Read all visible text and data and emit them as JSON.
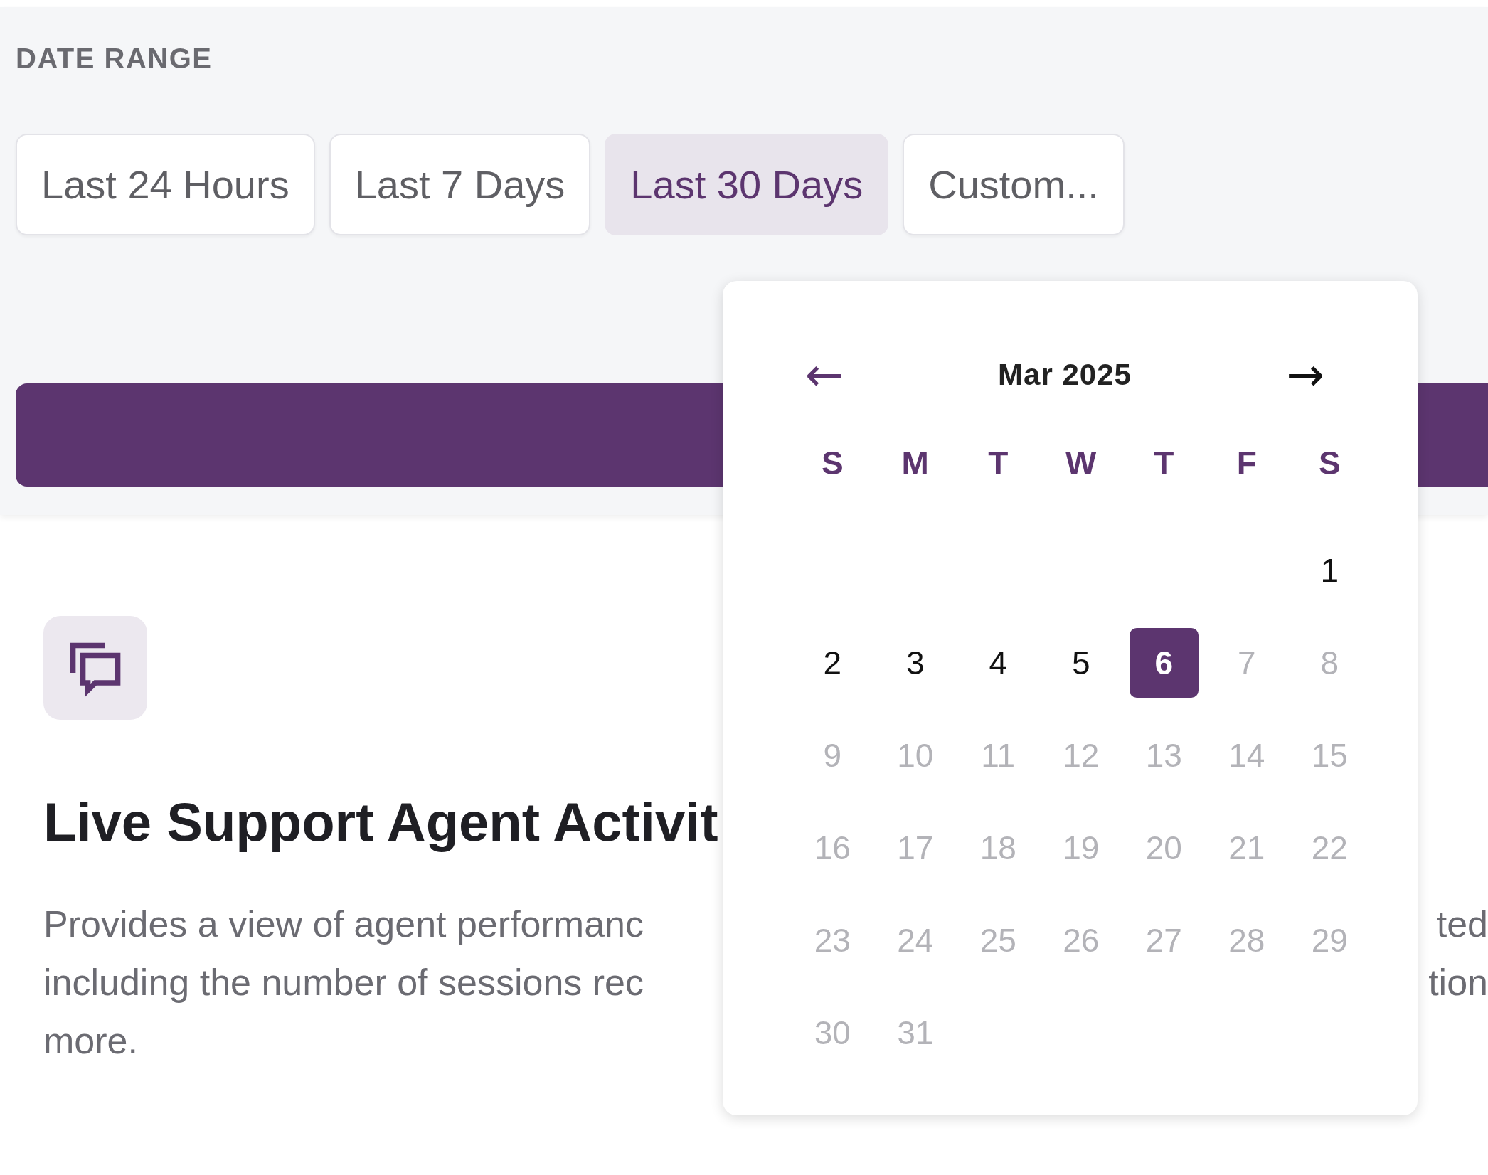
{
  "date_range": {
    "label": "DATE RANGE",
    "presets": [
      {
        "label": "Last 24 Hours",
        "selected": false
      },
      {
        "label": "Last 7 Days",
        "selected": false
      },
      {
        "label": "Last 30 Days",
        "selected": true
      },
      {
        "label": "Custom...",
        "selected": false
      }
    ]
  },
  "report": {
    "title": "Live Support Agent Activit",
    "description_lines": [
      {
        "left": "Provides a view of agent performanc",
        "right": "ted"
      },
      {
        "left": "including the number of sessions rec",
        "right": "tion"
      },
      {
        "left": "more."
      }
    ]
  },
  "calendar": {
    "prev": "←",
    "month": "Mar 2025",
    "next": "→",
    "weekdays": [
      "S",
      "M",
      "T",
      "W",
      "T",
      "F",
      "S"
    ],
    "weeks": [
      {
        "days": [
          {
            "day": "1",
            "selected": false,
            "disabled": false
          }
        ]
      },
      {
        "days": [
          {
            "day": "2",
            "selected": false,
            "disabled": false
          },
          {
            "day": "3",
            "selected": false,
            "disabled": false
          },
          {
            "day": "4",
            "selected": false,
            "disabled": false
          },
          {
            "day": "5",
            "selected": false,
            "disabled": false
          },
          {
            "day": "6",
            "selected": true,
            "disabled": false
          },
          {
            "day": "7",
            "selected": false,
            "disabled": true
          },
          {
            "day": "8",
            "selected": false,
            "disabled": true
          }
        ]
      },
      {
        "days": [
          {
            "day": "9",
            "selected": false,
            "disabled": true
          },
          {
            "day": "10",
            "selected": false,
            "disabled": true
          },
          {
            "day": "11",
            "selected": false,
            "disabled": true
          },
          {
            "day": "12",
            "selected": false,
            "disabled": true
          },
          {
            "day": "13",
            "selected": false,
            "disabled": true
          },
          {
            "day": "14",
            "selected": false,
            "disabled": true
          },
          {
            "day": "15",
            "selected": false,
            "disabled": true
          }
        ]
      },
      {
        "days": [
          {
            "day": "16",
            "selected": false,
            "disabled": true
          },
          {
            "day": "17",
            "selected": false,
            "disabled": true
          },
          {
            "day": "18",
            "selected": false,
            "disabled": true
          },
          {
            "day": "19",
            "selected": false,
            "disabled": true
          },
          {
            "day": "20",
            "selected": false,
            "disabled": true
          },
          {
            "day": "21",
            "selected": false,
            "disabled": true
          },
          {
            "day": "22",
            "selected": false,
            "disabled": true
          }
        ]
      },
      {
        "days": [
          {
            "day": "23",
            "selected": false,
            "disabled": true
          },
          {
            "day": "24",
            "selected": false,
            "disabled": true
          },
          {
            "day": "25",
            "selected": false,
            "disabled": true
          },
          {
            "day": "26",
            "selected": false,
            "disabled": true
          },
          {
            "day": "27",
            "selected": false,
            "disabled": true
          },
          {
            "day": "28",
            "selected": false,
            "disabled": true
          },
          {
            "day": "29",
            "selected": false,
            "disabled": true
          }
        ]
      },
      {
        "days": [
          {
            "day": "30",
            "selected": false,
            "disabled": true
          },
          {
            "day": "31",
            "selected": false,
            "disabled": true
          }
        ]
      }
    ]
  }
}
